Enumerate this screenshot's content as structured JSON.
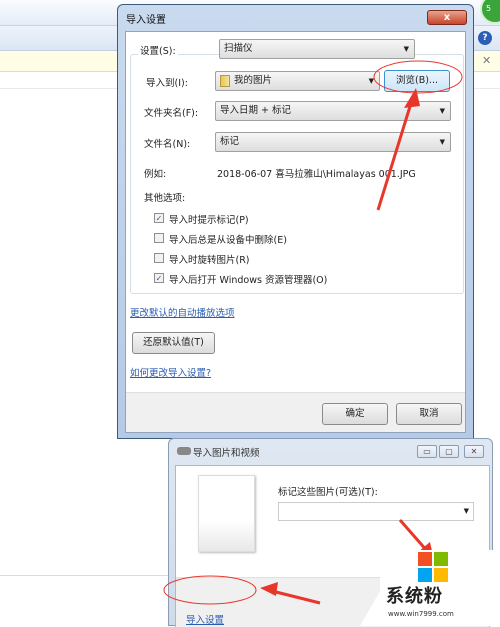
{
  "import_settings": {
    "title": "导入设置",
    "close_label": "x",
    "settings_label": "设置(S):",
    "settings_value": "扫描仪",
    "import_to_label": "导入到(I):",
    "import_to_value": "我的图片",
    "browse_label": "浏览(B)...",
    "folder_name_label": "文件夹名(F):",
    "folder_name_value": "导入日期 + 标记",
    "file_name_label": "文件名(N):",
    "file_name_value": "标记",
    "example_label": "例如:",
    "example_value": "2018-06-07 喜马拉雅山\\Himalayas 001.JPG",
    "other_options_label": "其他选项:",
    "options": [
      {
        "label": "导入时提示标记(P)",
        "checked": true
      },
      {
        "label": "导入后总是从设备中删除(E)",
        "checked": false
      },
      {
        "label": "导入时旋转图片(R)",
        "checked": false
      },
      {
        "label": "导入后打开 Windows 资源管理器(O)",
        "checked": true
      }
    ],
    "autoplay_link": "更改默认的自动播放选项",
    "restore_defaults": "还原默认值(T)",
    "how_to_link": "如何更改导入设置?",
    "ok_label": "确定",
    "cancel_label": "取消"
  },
  "import_pictures": {
    "title": "导入图片和视频",
    "tag_label": "标记这些图片(可选)(T):",
    "tag_value": "",
    "import_settings_link": "导入设置"
  },
  "watermark": {
    "brand": "系统粉",
    "url": "www.win7999.com",
    "colors": [
      "#f25022",
      "#7fba00",
      "#00a4ef",
      "#ffb900"
    ]
  },
  "annotation_color": "#e8362a"
}
